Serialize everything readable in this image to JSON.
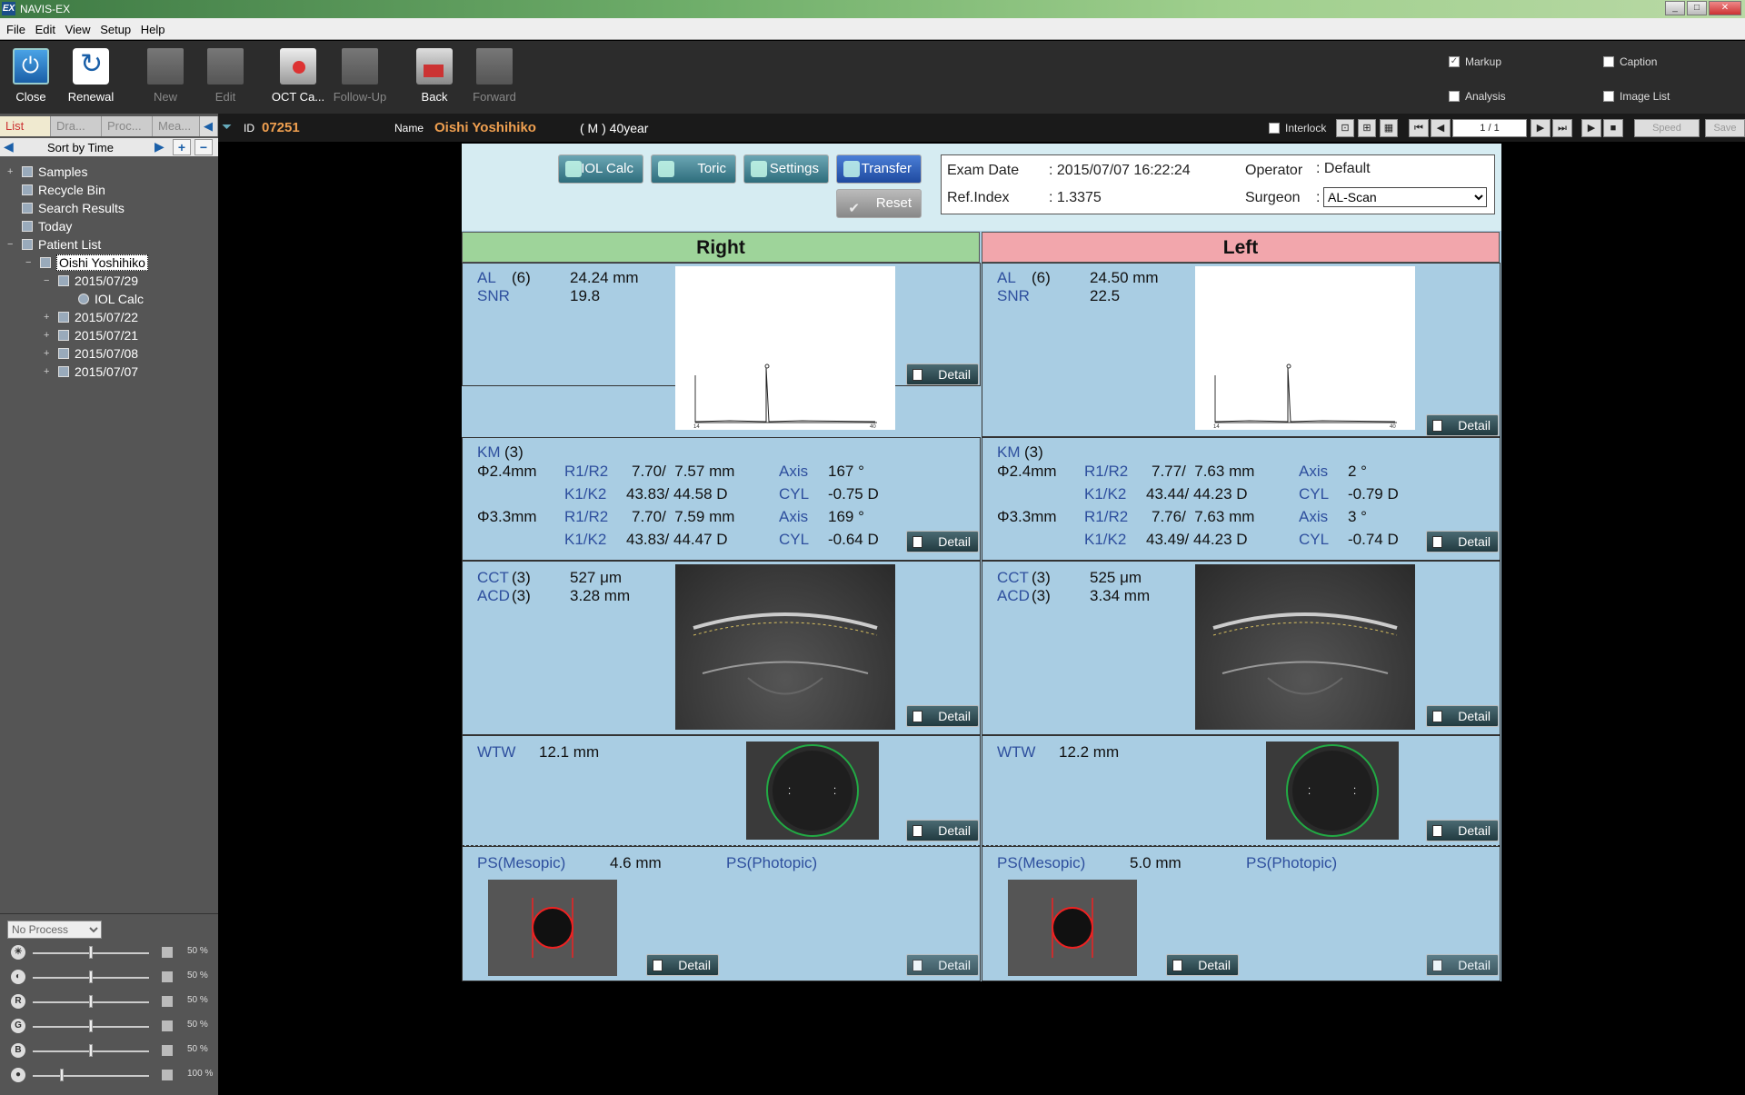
{
  "window": {
    "icon": "EX",
    "title": "NAVIS-EX"
  },
  "menu": [
    "File",
    "Edit",
    "View",
    "Setup",
    "Help"
  ],
  "toolbar": {
    "buttons": [
      {
        "label": "Close",
        "enabled": true
      },
      {
        "label": "Renewal",
        "enabled": true
      },
      {
        "label": "New",
        "enabled": false
      },
      {
        "label": "Edit",
        "enabled": false
      },
      {
        "label": "OCT Ca...",
        "enabled": true
      },
      {
        "label": "Follow-Up",
        "enabled": false
      },
      {
        "label": "Back",
        "enabled": true
      },
      {
        "label": "Forward",
        "enabled": false
      }
    ],
    "checks": {
      "markup": "Markup",
      "caption": "Caption",
      "analysis": "Analysis",
      "image_list": "Image List"
    }
  },
  "sidebar": {
    "tabs": [
      "List",
      "Dra...",
      "Proc...",
      "Mea..."
    ],
    "sort_label": "Sort by Time",
    "tree": {
      "samples": "Samples",
      "recycle_bin": "Recycle Bin",
      "search_results": "Search Results",
      "today": "Today",
      "patient_list": "Patient List",
      "patient": "Oishi  Yoshihiko",
      "d1": "2015/07/29",
      "iol": "IOL Calc",
      "d2": "2015/07/22",
      "d3": "2015/07/21",
      "d4": "2015/07/08",
      "d5": "2015/07/07"
    },
    "process_select": "No Process",
    "sliders": [
      "50 %",
      "50 %",
      "50 %",
      "50 %",
      "50 %",
      "100 %"
    ]
  },
  "patient": {
    "id_label": "ID",
    "id": "07251",
    "name_label": "Name",
    "name": "Oishi  Yoshihiko",
    "info": "( M )  40year"
  },
  "viewer": {
    "interlock": "Interlock",
    "page": "1 / 1",
    "speed": "Speed",
    "save": "Save"
  },
  "actions": {
    "iol": "IOL Calc",
    "toric": "Toric",
    "settings": "Settings",
    "transfer": "Transfer",
    "reset": "Reset"
  },
  "exam": {
    "date_label": "Exam Date",
    "date": ": 2015/07/07  16:22:24",
    "ref_label": "Ref.Index",
    "ref": ": 1.3375",
    "operator_label": "Operator",
    "operator": ":  Default",
    "surgeon_label": "Surgeon",
    "surgeon": ":",
    "surgeon_value": "AL-Scan"
  },
  "detail_label": "Detail",
  "eyes": {
    "right": {
      "title": "Right",
      "al_label": "AL",
      "al_n": "(6)",
      "al": "24.24 mm",
      "snr_label": "SNR",
      "snr": "19.8",
      "km_label": "KM",
      "km_n": "(3)",
      "d24": "Φ2.4mm",
      "d33": "Φ3.3mm",
      "r_label": "R1/R2",
      "k_label": "K1/K2",
      "axis_label": "Axis",
      "cyl_label": "CYL",
      "r24": "7.70/  7.57 mm",
      "k24": "43.83/ 44.58 D",
      "axis24": "167 °",
      "cyl24": "-0.75 D",
      "r33": "7.70/  7.59 mm",
      "k33": "43.83/ 44.47 D",
      "axis33": "169 °",
      "cyl33": "-0.64 D",
      "cct_label": "CCT",
      "cct_n": "(3)",
      "cct": "527 μm",
      "acd_label": "ACD",
      "acd_n": "(3)",
      "acd": "3.28 mm",
      "wtw_label": "WTW",
      "wtw": "12.1 mm",
      "ps_mesopic_label": "PS(Mesopic)",
      "ps_mesopic": "4.6 mm",
      "ps_photopic_label": "PS(Photopic)"
    },
    "left": {
      "title": "Left",
      "al_label": "AL",
      "al_n": "(6)",
      "al": "24.50 mm",
      "snr_label": "SNR",
      "snr": "22.5",
      "km_label": "KM",
      "km_n": "(3)",
      "d24": "Φ2.4mm",
      "d33": "Φ3.3mm",
      "r_label": "R1/R2",
      "k_label": "K1/K2",
      "axis_label": "Axis",
      "cyl_label": "CYL",
      "r24": "7.77/  7.63 mm",
      "k24": "43.44/ 44.23 D",
      "axis24": "2 °",
      "cyl24": "-0.79 D",
      "r33": "7.76/  7.63 mm",
      "k33": "43.49/ 44.23 D",
      "axis33": "3 °",
      "cyl33": "-0.74 D",
      "cct_label": "CCT",
      "cct_n": "(3)",
      "cct": "525 μm",
      "acd_label": "ACD",
      "acd_n": "(3)",
      "acd": "3.34 mm",
      "wtw_label": "WTW",
      "wtw": "12.2 mm",
      "ps_mesopic_label": "PS(Mesopic)",
      "ps_mesopic": "5.0 mm",
      "ps_photopic_label": "PS(Photopic)"
    }
  },
  "colors": {
    "right_header": "#9ed49a",
    "left_header": "#f2a6ac",
    "panel": "#a9cde3",
    "label": "#2e4f9e"
  }
}
